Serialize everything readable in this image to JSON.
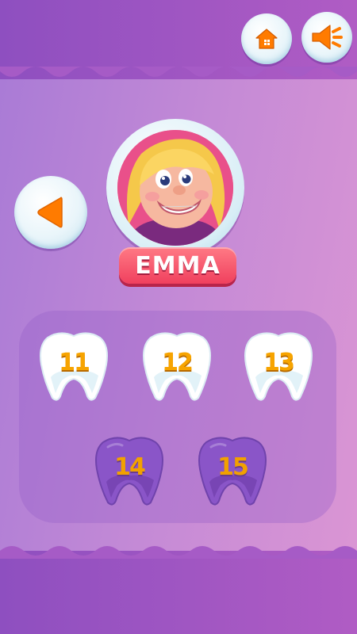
{
  "header": {
    "home_icon": "home-icon",
    "sound_icon": "speaker-icon"
  },
  "navigation": {
    "back_icon": "triangle-left-icon"
  },
  "character": {
    "name": "EMMA"
  },
  "levels": [
    {
      "label": "11",
      "state": "unlocked"
    },
    {
      "label": "12",
      "state": "unlocked"
    },
    {
      "label": "13",
      "state": "unlocked"
    },
    {
      "label": "14",
      "state": "locked"
    },
    {
      "label": "15",
      "state": "locked"
    }
  ],
  "colors": {
    "band": "#9b55c3",
    "accent_orange": "#ff7b00",
    "name_plate": "#f0405e",
    "number_gold": "#f7a400",
    "locked_tooth": "#8a55c8"
  }
}
